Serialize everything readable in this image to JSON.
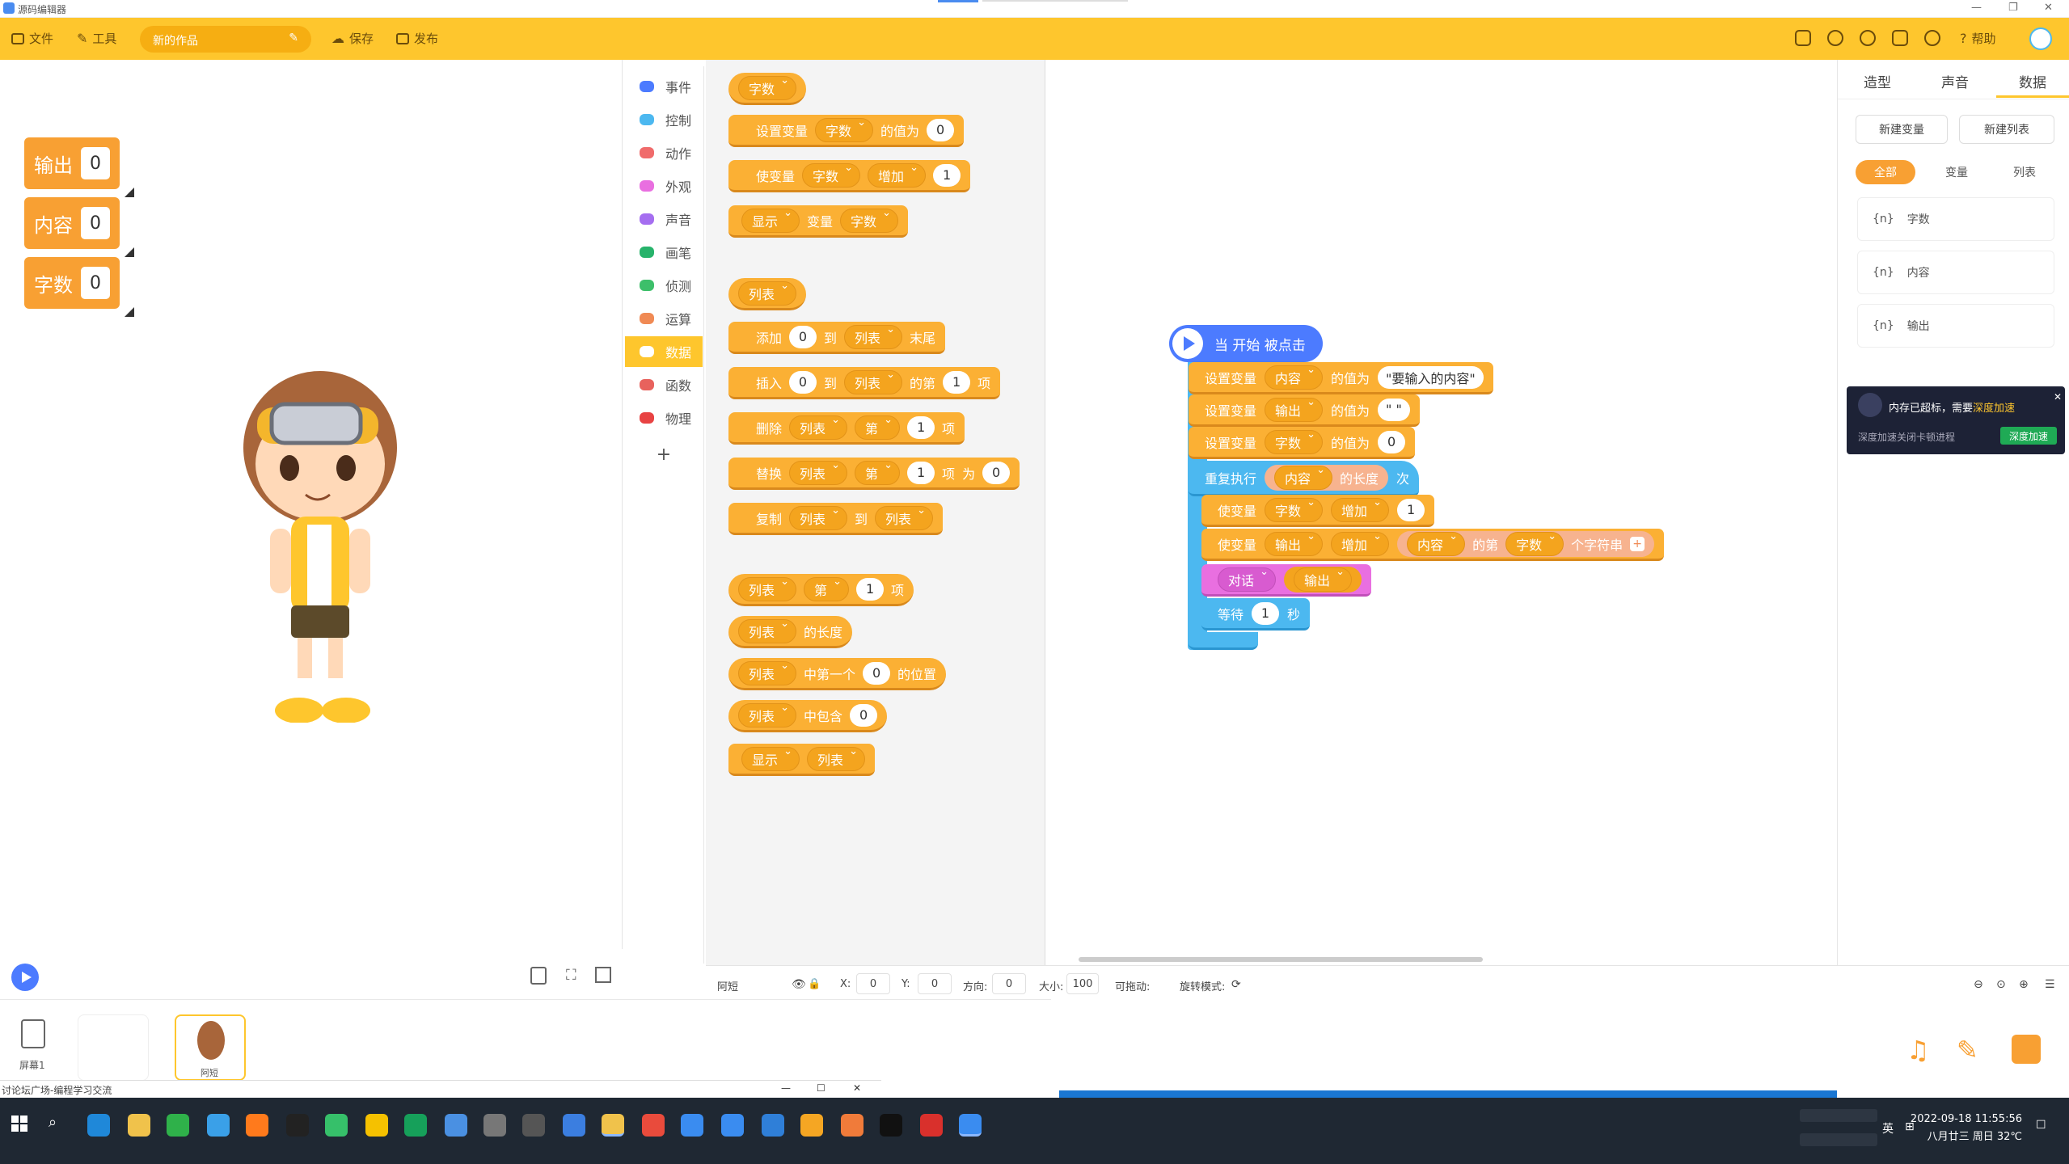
{
  "window": {
    "title": "源码编辑器"
  },
  "toolbar": {
    "file": "文件",
    "tools": "工具",
    "project_name": "新的作品",
    "save": "保存",
    "publish": "发布",
    "help": "帮助"
  },
  "stage": {
    "monitors": [
      {
        "label": "输出",
        "value": "0"
      },
      {
        "label": "内容",
        "value": "0"
      },
      {
        "label": "字数",
        "value": "0"
      }
    ]
  },
  "categories": [
    "事件",
    "控制",
    "动作",
    "外观",
    "声音",
    "画笔",
    "侦测",
    "运算",
    "数据",
    "函数",
    "物理"
  ],
  "category_colors": [
    "#4c7bff",
    "#4cb8f0",
    "#f06b6b",
    "#e96fe0",
    "#a56ef0",
    "#27b36b",
    "#3dbf6a",
    "#f08a54",
    "#fbb034",
    "#e8625d",
    "#e84343"
  ],
  "palette": {
    "var_reporter": "字数",
    "set_var": {
      "text1": "设置变量",
      "var": "字数",
      "text2": "的值为",
      "val": "0"
    },
    "change_var": {
      "text1": "使变量",
      "var": "字数",
      "op": "增加",
      "val": "1"
    },
    "show_var": {
      "op": "显示",
      "text": "变量",
      "var": "字数"
    },
    "list_reporter": "列表",
    "add_list": {
      "t1": "添加",
      "v": "0",
      "t2": "到",
      "list": "列表",
      "t3": "末尾"
    },
    "insert_list": {
      "t1": "插入",
      "v": "0",
      "t2": "到",
      "list": "列表",
      "t3": "的第",
      "idx": "1",
      "t4": "项"
    },
    "delete_list": {
      "t1": "删除",
      "list": "列表",
      "pos": "第",
      "idx": "1",
      "t2": "项"
    },
    "replace_list": {
      "t1": "替换",
      "list": "列表",
      "pos": "第",
      "idx": "1",
      "t2": "项",
      "t3": "为",
      "val": "0"
    },
    "copy_list": {
      "t1": "复制",
      "list": "列表",
      "t2": "到",
      "list2": "列表"
    },
    "item_of": {
      "list": "列表",
      "pos": "第",
      "idx": "1",
      "t": "项"
    },
    "length_of": {
      "list": "列表",
      "t": "的长度"
    },
    "index_of": {
      "list": "列表",
      "t1": "中第一个",
      "v": "0",
      "t2": "的位置"
    },
    "contains": {
      "list": "列表",
      "t": "中包含",
      "v": "0"
    },
    "show_list": {
      "op": "显示",
      "list": "列表"
    }
  },
  "script": {
    "hat": "当 开始 被点击",
    "set1": {
      "t1": "设置变量",
      "var": "内容",
      "t2": "的值为",
      "val": "\"要输入的内容\""
    },
    "set2": {
      "t1": "设置变量",
      "var": "输出",
      "t2": "的值为",
      "val": "\" \""
    },
    "set3": {
      "t1": "设置变量",
      "var": "字数",
      "t2": "的值为",
      "val": "0"
    },
    "repeat": {
      "t1": "重复执行",
      "var": "内容",
      "t2": "的长度",
      "t3": "次"
    },
    "change1": {
      "t1": "使变量",
      "var": "字数",
      "op": "增加",
      "val": "1"
    },
    "change2": {
      "t1": "使变量",
      "var": "输出",
      "op": "增加",
      "src": "内容",
      "t2": "的第",
      "idx": "字数",
      "t3": "个字符串"
    },
    "say": {
      "op": "对话",
      "var": "输出"
    },
    "wait": {
      "t1": "等待",
      "val": "1",
      "t2": "秒"
    }
  },
  "propbar": {
    "name": "阿短",
    "x_label": "X:",
    "x": "0",
    "y_label": "Y:",
    "y": "0",
    "dir_label": "方向:",
    "dir": "0",
    "size_label": "大小:",
    "size": "100",
    "drag_label": "可拖动:",
    "rot_label": "旋转模式:"
  },
  "right_panel": {
    "tabs": [
      "造型",
      "声音",
      "数据"
    ],
    "new_var": "新建变量",
    "new_list": "新建列表",
    "filters": [
      "全部",
      "变量",
      "列表"
    ],
    "vars": [
      "字数",
      "内容",
      "输出"
    ],
    "var_icon": "{n}"
  },
  "popup": {
    "title": "内存已超标，需要",
    "link": "深度加速",
    "sub": "深度加速关闭卡顿进程",
    "btn": "深度加速"
  },
  "tray": {
    "screen": "屏幕1",
    "sprite": "阿短"
  },
  "browser": {
    "tab_title": "讨论坛广场-编程学习交流"
  },
  "taskbar": {
    "date": "2022-09-18 11:55:56",
    "lunar": "八月廿三 周日 32℃",
    "ime": "英"
  }
}
